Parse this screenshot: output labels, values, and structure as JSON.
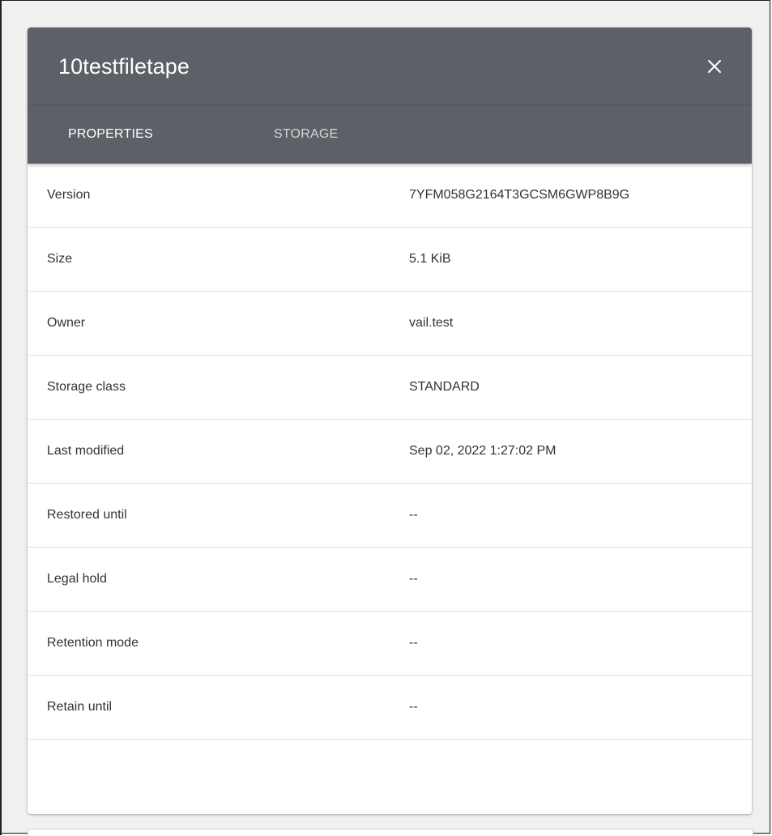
{
  "dialog": {
    "title": "10testfiletape",
    "close_icon": "close-icon"
  },
  "tabs": [
    {
      "label": "PROPERTIES",
      "active": true
    },
    {
      "label": "STORAGE",
      "active": false
    }
  ],
  "properties": [
    {
      "label": "Version",
      "value": "7YFM058G2164T3GCSM6GWP8B9G"
    },
    {
      "label": "Size",
      "value": "5.1 KiB"
    },
    {
      "label": "Owner",
      "value": "vail.test"
    },
    {
      "label": "Storage class",
      "value": "STANDARD"
    },
    {
      "label": "Last modified",
      "value": "Sep 02, 2022 1:27:02 PM"
    },
    {
      "label": "Restored until",
      "value": "--"
    },
    {
      "label": "Legal hold",
      "value": "--"
    },
    {
      "label": "Retention mode",
      "value": "--"
    },
    {
      "label": "Retain until",
      "value": "--"
    }
  ],
  "colors": {
    "header_bg": "#5d6066",
    "active_tab_text": "#ffffff",
    "inactive_tab_text": "#d3d4d6",
    "row_divider": "#e2e2e2",
    "body_text": "#333333"
  }
}
